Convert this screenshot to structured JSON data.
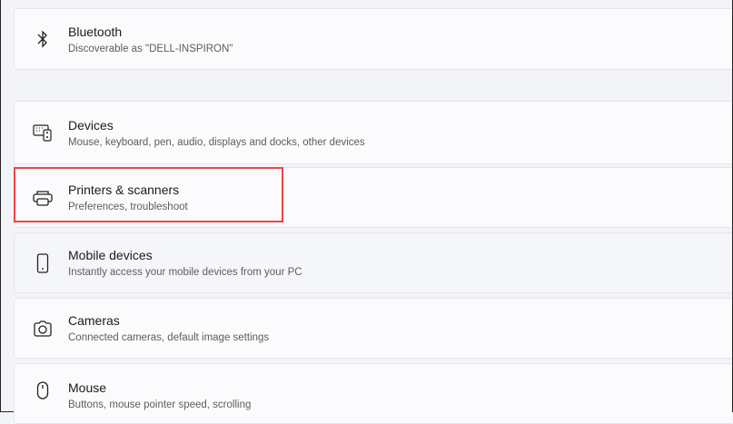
{
  "items": [
    {
      "title": "Bluetooth",
      "subtitle": "Discoverable as \"DELL-INSPIRON\"",
      "icon": "bluetooth-icon"
    },
    {
      "title": "Devices",
      "subtitle": "Mouse, keyboard, pen, audio, displays and docks, other devices",
      "icon": "devices-icon"
    },
    {
      "title": "Printers & scanners",
      "subtitle": "Preferences, troubleshoot",
      "icon": "printer-icon"
    },
    {
      "title": "Mobile devices",
      "subtitle": "Instantly access your mobile devices from your PC",
      "icon": "phone-icon"
    },
    {
      "title": "Cameras",
      "subtitle": "Connected cameras, default image settings",
      "icon": "camera-icon"
    },
    {
      "title": "Mouse",
      "subtitle": "Buttons, mouse pointer speed, scrolling",
      "icon": "mouse-icon"
    }
  ],
  "highlight_color": "#ef4444"
}
